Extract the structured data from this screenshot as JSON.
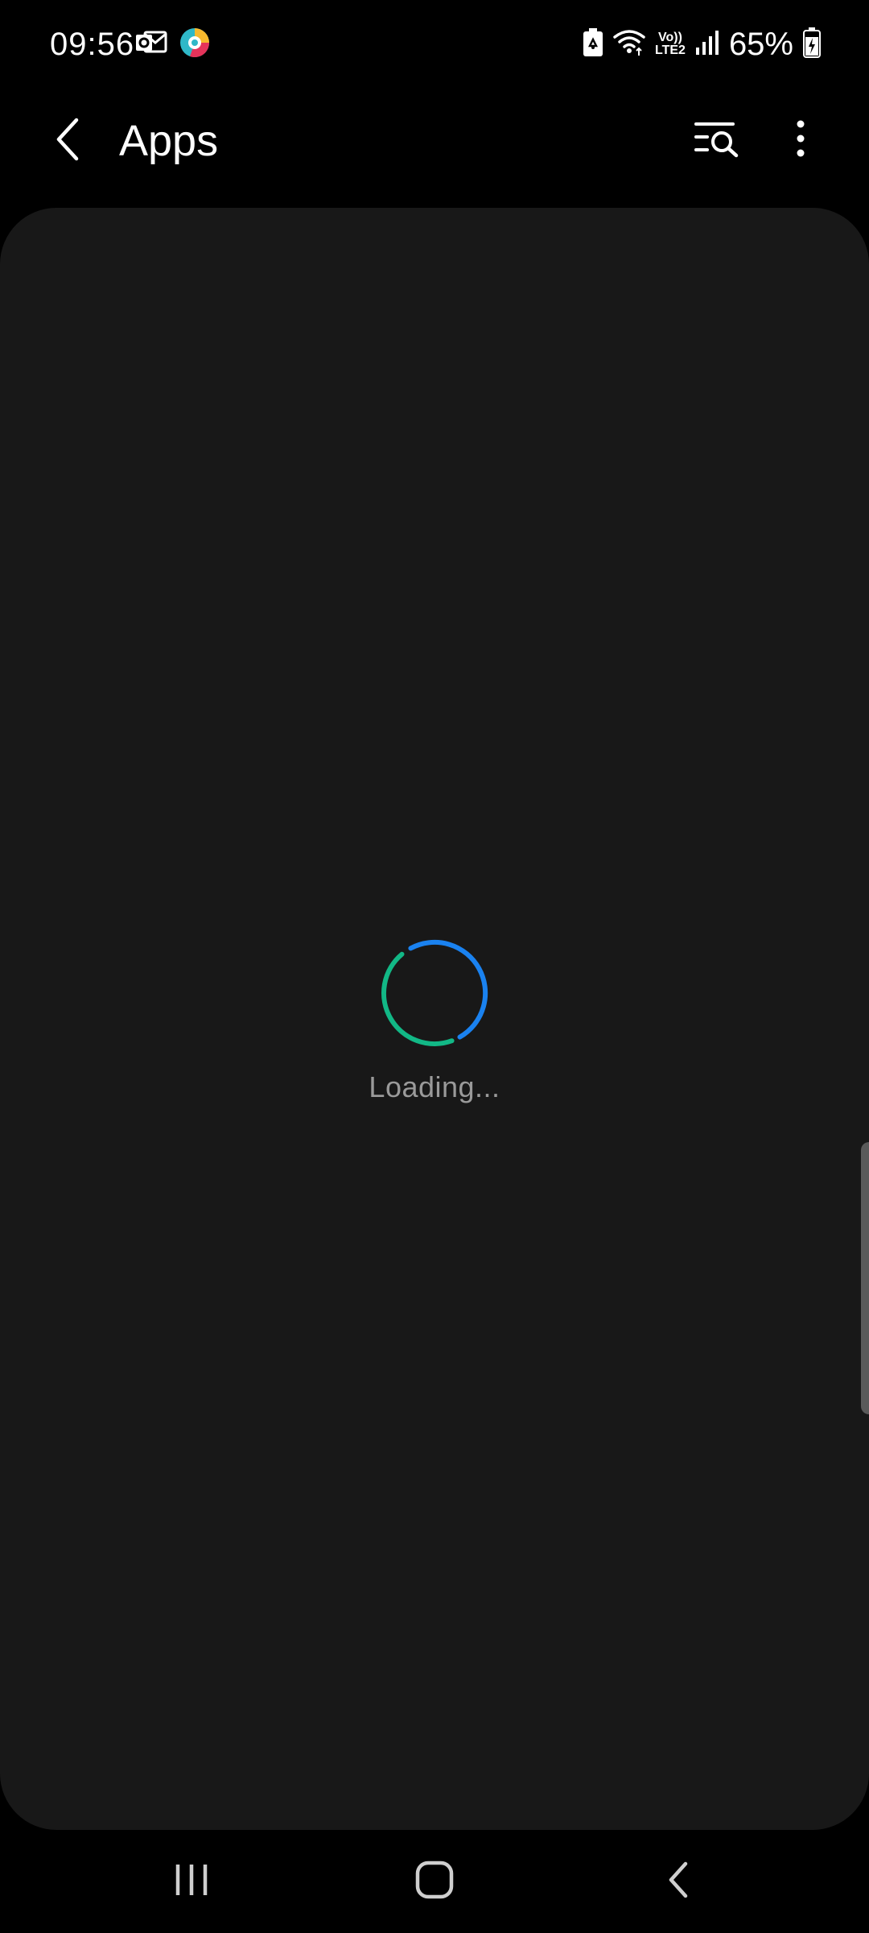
{
  "status_bar": {
    "time": "09:56",
    "battery_percent": "65%",
    "network_label_top": "Vo))",
    "network_label_bottom": "LTE2",
    "icons": [
      "outlook-notification-icon",
      "browser-notification-icon",
      "battery-saver-icon",
      "wifi-icon",
      "volte-icon",
      "signal-icon",
      "battery-charging-icon"
    ]
  },
  "app_bar": {
    "title": "Apps",
    "back_icon": "chevron-left-icon",
    "search_icon": "list-search-icon",
    "more_icon": "more-vertical-icon"
  },
  "content": {
    "loading_text": "Loading...",
    "spinner_colors": {
      "primary": "#1a82f0",
      "secondary": "#12b886"
    },
    "card_color": "#181818"
  },
  "nav_bar": {
    "icons": [
      "recents-icon",
      "home-icon",
      "back-icon"
    ]
  },
  "colors": {
    "background": "#000000",
    "text_primary": "#ffffff",
    "text_secondary": "#9a9a9a"
  }
}
